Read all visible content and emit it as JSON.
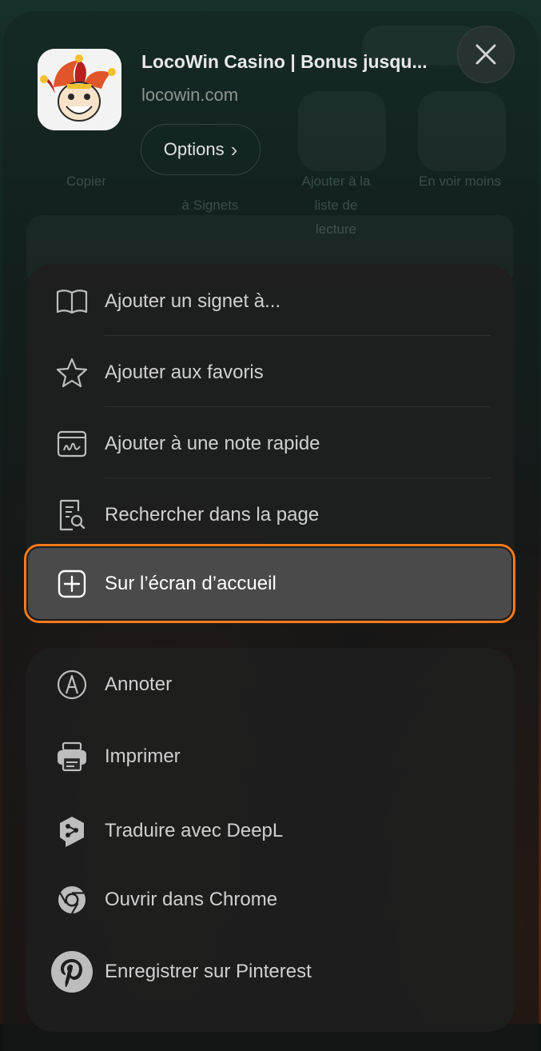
{
  "background_hints": {
    "row_labels": [
      "Copier",
      "Ajouter à la",
      "liste de",
      "lecture",
      "En voir moins",
      "à Signets"
    ]
  },
  "header": {
    "site_title": "LocoWin Casino | Bonus jusqu...",
    "site_domain": "locowin.com",
    "options_label": "Options",
    "options_chevron": "›",
    "close_icon": "close-icon",
    "app_icon": "jester-logo-icon"
  },
  "menu_group_1": {
    "items": [
      {
        "label": "Ajouter un signet à...",
        "icon": "book-icon"
      },
      {
        "label": "Ajouter aux favoris",
        "icon": "star-icon"
      },
      {
        "label": "Ajouter à une note rapide",
        "icon": "quick-note-icon"
      },
      {
        "label": "Rechercher dans la page",
        "icon": "find-in-page-icon"
      },
      {
        "label": "Sur l’écran d’accueil",
        "icon": "add-square-icon",
        "highlighted": true
      }
    ]
  },
  "menu_group_2": {
    "items": [
      {
        "label": "Annoter",
        "icon": "markup-pen-icon"
      },
      {
        "label": "Imprimer",
        "icon": "printer-icon"
      },
      {
        "label": "Traduire avec DeepL",
        "icon": "deepl-icon"
      },
      {
        "label": "Ouvrir dans Chrome",
        "icon": "chrome-icon"
      },
      {
        "label": "Enregistrer sur Pinterest",
        "icon": "pinterest-icon"
      }
    ]
  },
  "colors": {
    "highlight_outline": "#ff7a1a",
    "highlight_fill": "#4a4a4a",
    "menu_bg": "#1e1e1e"
  }
}
